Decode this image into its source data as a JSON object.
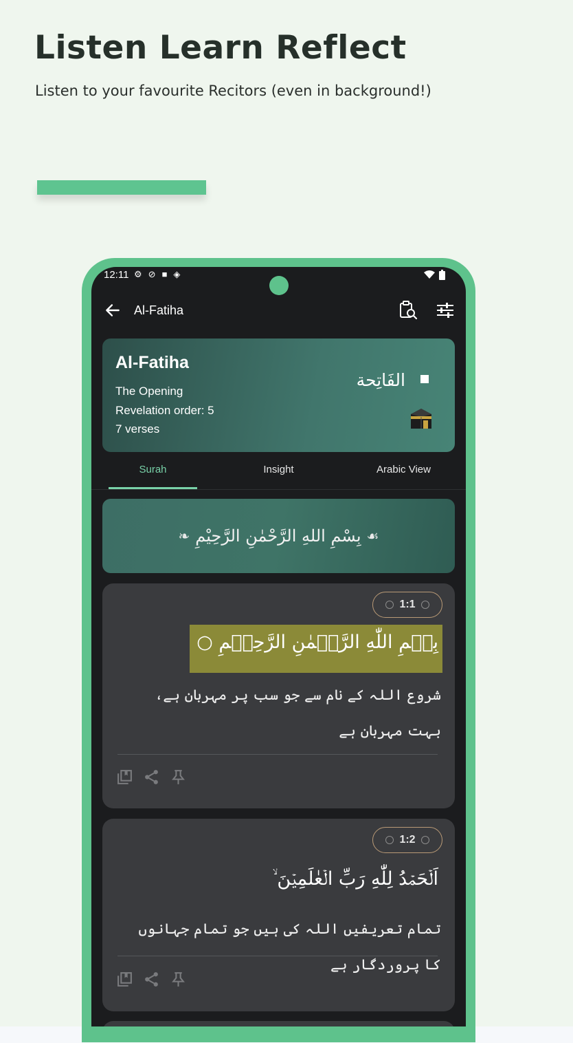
{
  "hero": {
    "title": "Listen Learn Reflect",
    "subtitle": "Listen to your favourite Recitors (even in background!)"
  },
  "status_bar": {
    "time": "12:11"
  },
  "app_bar": {
    "title": "Al-Fatiha",
    "back_icon": "arrow-left-icon",
    "actions": [
      "clipboard-search-icon",
      "tune-icon"
    ]
  },
  "surah": {
    "name": "Al-Fatiha",
    "meaning": "The Opening",
    "revelation_order": "Revelation order: 5",
    "verses": "7 verses",
    "arabic_name": "الفَاتِحة"
  },
  "tabs": [
    {
      "label": "Surah",
      "active": true
    },
    {
      "label": "Insight",
      "active": false
    },
    {
      "label": "Arabic View",
      "active": false
    }
  ],
  "bismillah": "بِسْمِ اللهِ الرَّحْمٰنِ الرَّحِيْمِ",
  "verses": [
    {
      "number": "1:1",
      "arabic": "بِسۡمِ اللّٰهِ الرَّحۡمٰنِ الرَّحِيۡمِ ○",
      "translation": "شروع اللہ کے نام سے جو سب پر مہربان ہے، بہت مہربان ہے"
    },
    {
      "number": "1:2",
      "arabic": "اَلۡحَمۡدُ لِلّٰهِ رَبِّ الۡعٰلَمِيۡنَ ۙ",
      "translation": "تمام تعریفیں اللہ کی ہیں جو تمام جہانوں کا پروردگار ہے"
    }
  ],
  "colors": {
    "background": "#eff6ee",
    "accent": "#5ec490",
    "tab_active": "#78d1a8",
    "highlight": "#8b8a38"
  }
}
